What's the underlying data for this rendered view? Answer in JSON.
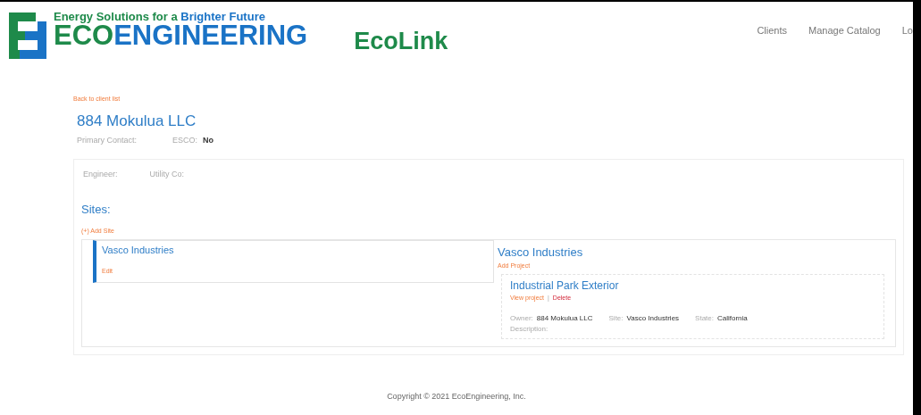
{
  "header": {
    "tagline_left": "Energy Solutions for a",
    "tagline_right": "Brighter Future",
    "brand_left": "ECO",
    "brand_right": "ENGINEERING",
    "app_name": "EcoLink"
  },
  "nav": [
    {
      "label": "Clients"
    },
    {
      "label": "Manage Catalog"
    },
    {
      "label": "Lo"
    }
  ],
  "back_link": "Back to client list",
  "client": {
    "name": "884 Mokulua LLC",
    "fields": [
      {
        "label": "Primary Contact:"
      },
      {
        "label": "ESCO:",
        "value": "No"
      }
    ]
  },
  "details": [
    {
      "label": "Engineer:"
    },
    {
      "label": "Utility Co:"
    }
  ],
  "sites_heading": "Sites:",
  "add_site": "(+) Add Site",
  "sites": [
    {
      "name": "Vasco Industries",
      "action": "Edit",
      "selected": true
    }
  ],
  "selected_site": {
    "name": "Vasco Industries",
    "add_project": "Add Project",
    "projects": [
      {
        "title": "Industrial Park Exterior",
        "view": "View project",
        "separator": "|",
        "delete": "Delete",
        "fields": [
          {
            "label": "Owner:",
            "value": "884 Mokulua LLC"
          },
          {
            "label": "Site:",
            "value": "Vasco Industries"
          },
          {
            "label": "State:",
            "value": "California"
          }
        ],
        "description_label": "Description:"
      }
    ]
  },
  "footer": "Copyright © 2021 EcoEngineering, Inc."
}
